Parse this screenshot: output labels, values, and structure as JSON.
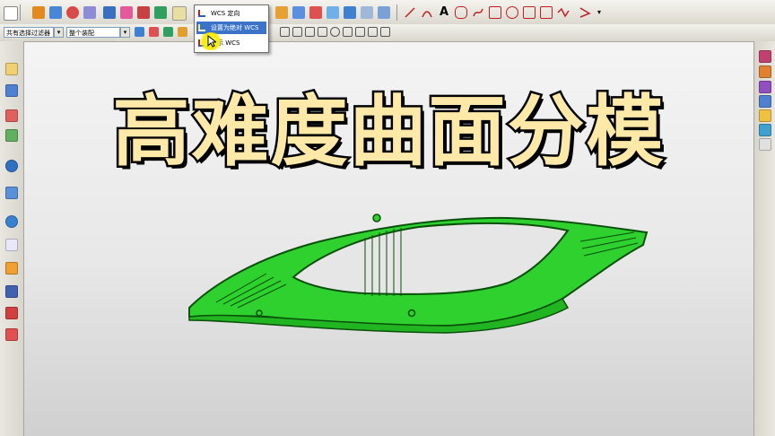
{
  "title_overlay": "高难度曲面分模",
  "filters": {
    "selection_filter": "共有选择过滤器",
    "assembly_scope": "整个装配"
  },
  "wcs_menu": {
    "items": [
      {
        "label": "WCS 定向",
        "selected": false
      },
      {
        "label": "设置为绝对 WCS",
        "selected": true
      },
      {
        "label": "显示 WCS",
        "selected": false
      }
    ]
  },
  "colors": {
    "model_green": "#2fd12f",
    "model_dark": "#0a4f0a",
    "title_fill": "#ffe9a8",
    "highlight": "#3b73c9"
  },
  "icons": {
    "toolbar_top": [
      "new-file-icon",
      "cube-icon",
      "sketch-icon",
      "sphere-icon",
      "shell-icon",
      "extrude-icon",
      "edge-blend-icon",
      "revolve-icon",
      "point-icon",
      "datum-icon",
      "wcs-icon",
      "dropdown-icon",
      "surface-icon",
      "mesh-icon",
      "sweep-icon",
      "thicken-icon",
      "offset-icon",
      "trim-icon",
      "pattern-icon",
      "view-cube-icon",
      "line-icon",
      "arc-icon",
      "text-icon",
      "dimension-icon",
      "curve-icon",
      "snap-icon",
      "measure-icon",
      "layer-icon",
      "analysis-icon",
      "display-icon",
      "expand-icon"
    ],
    "toolbar_second": [
      "filter-icon",
      "select-icon",
      "snap-endpoint-icon",
      "snap-midpoint-icon",
      "snap-center-icon",
      "snap-intersect-icon",
      "snap-point-icon",
      "snap-quadrant-icon",
      "snap-tangent-icon"
    ],
    "left_bar": [
      "assembly-navigator-icon",
      "constraint-icon",
      "part-navigator-icon",
      "history-icon",
      "reuse-library-icon",
      "roles-icon",
      "web-browser-icon",
      "history-palette-icon",
      "system-materials-icon",
      "process-studio-icon",
      "manufacturing-wizard-icon",
      "role-icon"
    ],
    "right_bar": [
      "mold-wizard-icon",
      "parting-icon",
      "cavity-icon",
      "layout-icon",
      "family-icon",
      "library-icon",
      "standard-part-icon"
    ]
  }
}
